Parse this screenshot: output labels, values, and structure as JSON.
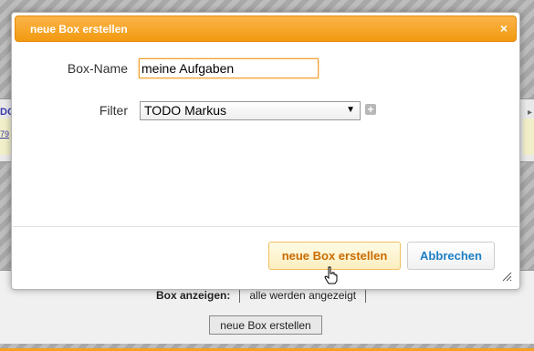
{
  "background": {
    "fragment_1": "DO",
    "fragment_2": "79",
    "fragment_3": "▸",
    "box_show_label": "Box anzeigen:",
    "box_show_value": "alle werden angezeigt",
    "new_box_button": "neue Box erstellen"
  },
  "dialog": {
    "title": "neue Box erstellen",
    "close_icon": "×",
    "box_name_label": "Box-Name",
    "box_name_value": "meine Aufgaben",
    "filter_label": "Filter",
    "filter_value": "TODO Markus",
    "plus_icon": "+",
    "create_button": "neue Box erstellen",
    "cancel_button": "Abbrechen"
  },
  "colors": {
    "accent": "#f29a10",
    "link": "#1d7fc4",
    "create_text": "#c96b00"
  }
}
